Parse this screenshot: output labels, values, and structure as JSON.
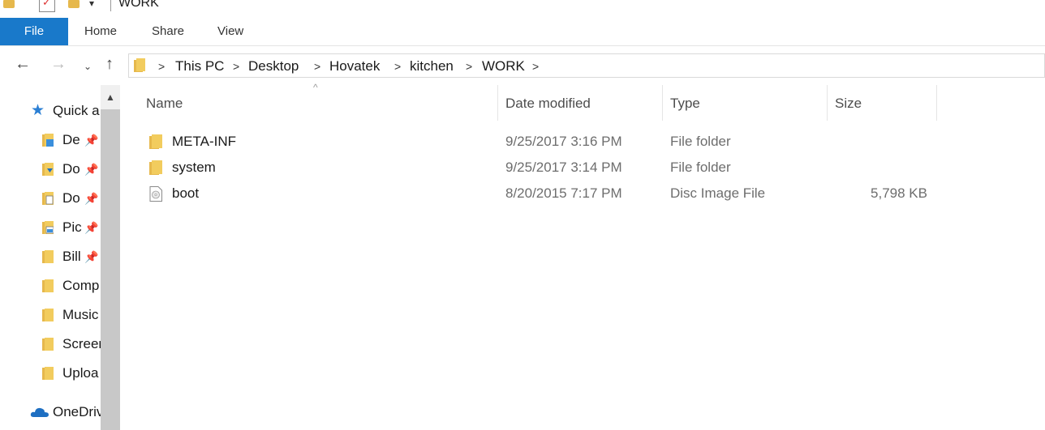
{
  "window": {
    "title": "WORK"
  },
  "ribbon": {
    "tabs": [
      "File",
      "Home",
      "Share",
      "View"
    ]
  },
  "address": {
    "crumbs": [
      "This PC",
      "Desktop",
      "Hovatek",
      "kitchen",
      "WORK"
    ]
  },
  "navpane": {
    "quick_access": "Quick a",
    "items": [
      {
        "label": "De",
        "pinned": true,
        "icon": "desktop-folder-icon"
      },
      {
        "label": "Do",
        "pinned": true,
        "icon": "downloads-folder-icon"
      },
      {
        "label": "Do",
        "pinned": true,
        "icon": "documents-folder-icon"
      },
      {
        "label": "Pic",
        "pinned": true,
        "icon": "pictures-folder-icon"
      },
      {
        "label": "Bill",
        "pinned": true,
        "icon": "folder-icon"
      },
      {
        "label": "Comp",
        "pinned": false,
        "icon": "folder-icon"
      },
      {
        "label": "Music",
        "pinned": false,
        "icon": "folder-icon"
      },
      {
        "label": "Screen",
        "pinned": false,
        "icon": "folder-icon"
      },
      {
        "label": "Uploa",
        "pinned": false,
        "icon": "folder-icon"
      }
    ],
    "onedrive": "OneDriv"
  },
  "columns": {
    "name": "Name",
    "date": "Date modified",
    "type": "Type",
    "size": "Size"
  },
  "files": [
    {
      "name": "META-INF",
      "date": "9/25/2017 3:16 PM",
      "type": "File folder",
      "size": "",
      "icon": "folder-icon"
    },
    {
      "name": "system",
      "date": "9/25/2017 3:14 PM",
      "type": "File folder",
      "size": "",
      "icon": "folder-icon"
    },
    {
      "name": "boot",
      "date": "8/20/2015 7:17 PM",
      "type": "Disc Image File",
      "size": "5,798 KB",
      "icon": "disc-image-icon"
    }
  ],
  "colors": {
    "accent": "#1979ca",
    "folder": "#e6b84c",
    "scrollbar": "#c8c8c8"
  }
}
